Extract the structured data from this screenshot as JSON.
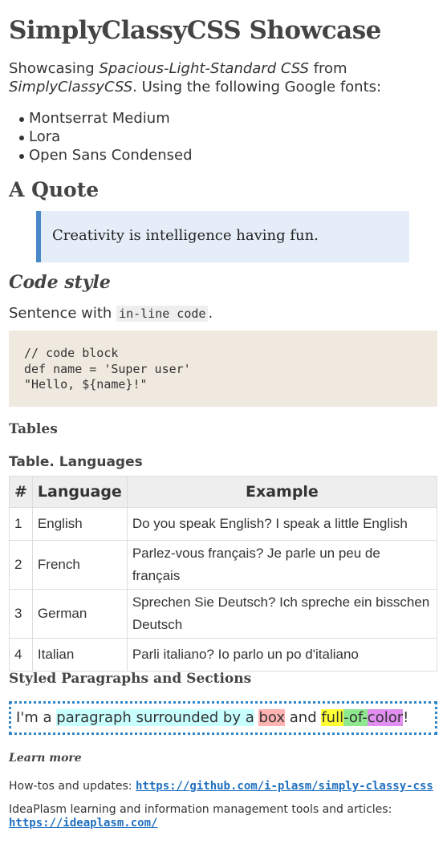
{
  "title": "SimplyClassyCSS Showcase",
  "intro": {
    "prefix": "Showcasing ",
    "css_name": "Spacious-Light-Standard CSS",
    "middle": " from ",
    "site_name": "SimplyClassyCSS",
    "suffix": ". Using the following Google fonts:"
  },
  "fonts_list": [
    "Montserrat Medium",
    "Lora",
    "Open Sans Condensed"
  ],
  "quote_section": {
    "heading": "A Quote",
    "text": "Creativity is intelligence having fun."
  },
  "code_section": {
    "heading": "Code style",
    "sentence_prefix": "Sentence with ",
    "inline_code": "in-line code",
    "sentence_suffix": ".",
    "code_lines": [
      "// code block",
      "def name = 'Super user'",
      "\"Hello, ${name}!\""
    ]
  },
  "tables_section": {
    "heading": "Tables",
    "caption": "Table. Languages",
    "headers": [
      "#",
      "Language",
      "Example"
    ],
    "rows": [
      {
        "num": "1",
        "language": "English",
        "example": "Do you speak English? I speak a little English"
      },
      {
        "num": "2",
        "language": "French",
        "example": "Parlez-vous français? Je parle un peu de français"
      },
      {
        "num": "3",
        "language": "German",
        "example": "Sprechen Sie Deutsch? Ich spreche ein bisschen Deutsch"
      },
      {
        "num": "4",
        "language": "Italian",
        "example": "Parli italiano? Io parlo un po d'italiano"
      }
    ]
  },
  "styled_section": {
    "heading": "Styled Paragraphs and Sections",
    "parts": {
      "p1": "I'm a ",
      "p2": "paragraph surrounded by a",
      "p3": " ",
      "p4": "box",
      "p5": " and ",
      "p6": "full",
      "p7": "-of-",
      "p8": "color",
      "p9": "!"
    }
  },
  "learn_more": {
    "heading": "Learn more",
    "line1_prefix": "How-tos and updates: ",
    "line1_link": "https://github.com/i-plasm/simply-classy-css",
    "line2_prefix": "IdeaPlasm learning and information management tools and articles: ",
    "line2_link": "https://ideaplasm.com/"
  },
  "colors": {
    "quote_bg": "#e5eef8",
    "quote_border": "#4a89c8",
    "code_bg": "#f0e9df",
    "link": "#1f6fc0",
    "box_border": "#2f86c9"
  }
}
